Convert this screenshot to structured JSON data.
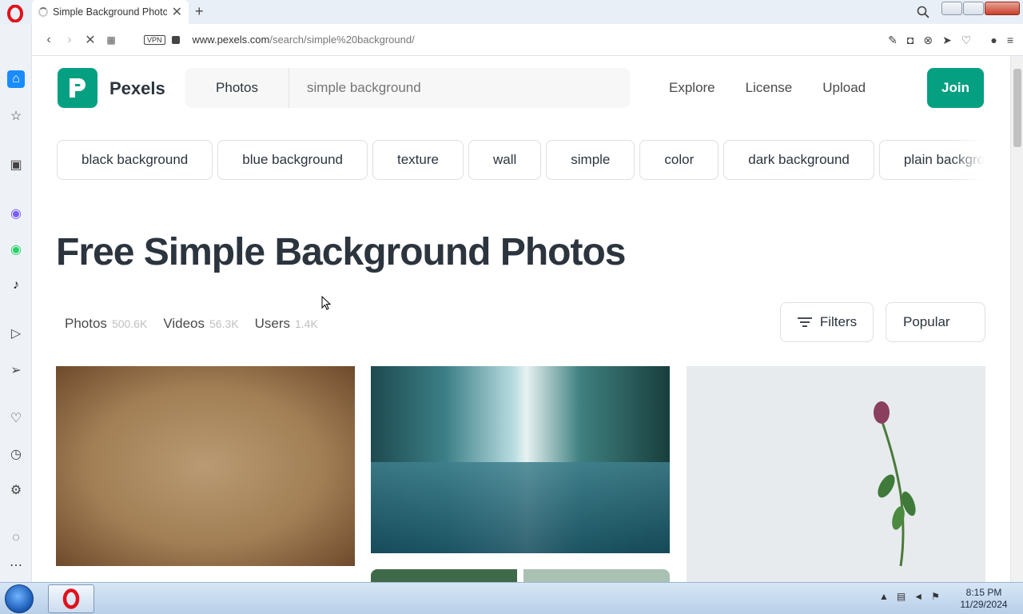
{
  "browser": {
    "tab_title": "Simple Background Photos",
    "url_domain": "www.pexels.com",
    "url_path": "/search/simple%20background/",
    "vpn_label": "VPN"
  },
  "header": {
    "brand": "Pexels",
    "search_type": "Photos",
    "search_placeholder": "simple background",
    "nav": [
      "Explore",
      "License",
      "Upload"
    ],
    "join_label": "Join"
  },
  "chips": [
    "black background",
    "blue background",
    "texture",
    "wall",
    "simple",
    "color",
    "dark background",
    "plain background"
  ],
  "heading": "Free Simple Background Photos",
  "media_tabs": [
    {
      "label": "Photos",
      "count": "500.6K"
    },
    {
      "label": "Videos",
      "count": "56.3K"
    },
    {
      "label": "Users",
      "count": "1.4K"
    }
  ],
  "filters_label": "Filters",
  "sort_label": "Popular",
  "taskbar": {
    "time": "8:15 PM",
    "date": "11/29/2024"
  },
  "colors": {
    "brand": "#05a081",
    "text": "#2c343e"
  }
}
